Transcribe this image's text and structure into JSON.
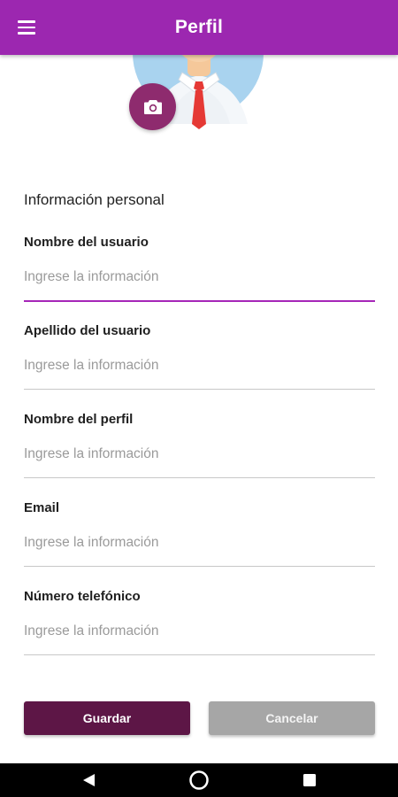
{
  "appbar": {
    "title": "Perfil",
    "menu_icon": "hamburger-menu-icon",
    "background_color": "#9c27b0"
  },
  "avatar": {
    "camera_icon": "camera-icon",
    "camera_button_color": "#8e2b6e"
  },
  "section": {
    "title": "Información personal"
  },
  "fields": [
    {
      "label": "Nombre del usuario",
      "placeholder": "Ingrese la información",
      "value": "",
      "focused": true
    },
    {
      "label": "Apellido del usuario",
      "placeholder": "Ingrese la información",
      "value": "",
      "focused": false
    },
    {
      "label": "Nombre del perfil",
      "placeholder": "Ingrese la información",
      "value": "",
      "focused": false
    },
    {
      "label": "Email",
      "placeholder": "Ingrese la información",
      "value": "",
      "focused": false
    },
    {
      "label": "Número telefónico",
      "placeholder": "Ingrese la información",
      "value": "",
      "focused": false
    }
  ],
  "buttons": {
    "save_label": "Guardar",
    "cancel_label": "Cancelar",
    "save_color": "#5d1646",
    "cancel_color": "#a6a6a6"
  },
  "system_nav": {
    "back_icon": "back-triangle-icon",
    "home_icon": "home-circle-icon",
    "recents_icon": "recents-square-icon"
  },
  "colors": {
    "accent": "#a626b8",
    "divider": "#c8c8c8"
  }
}
